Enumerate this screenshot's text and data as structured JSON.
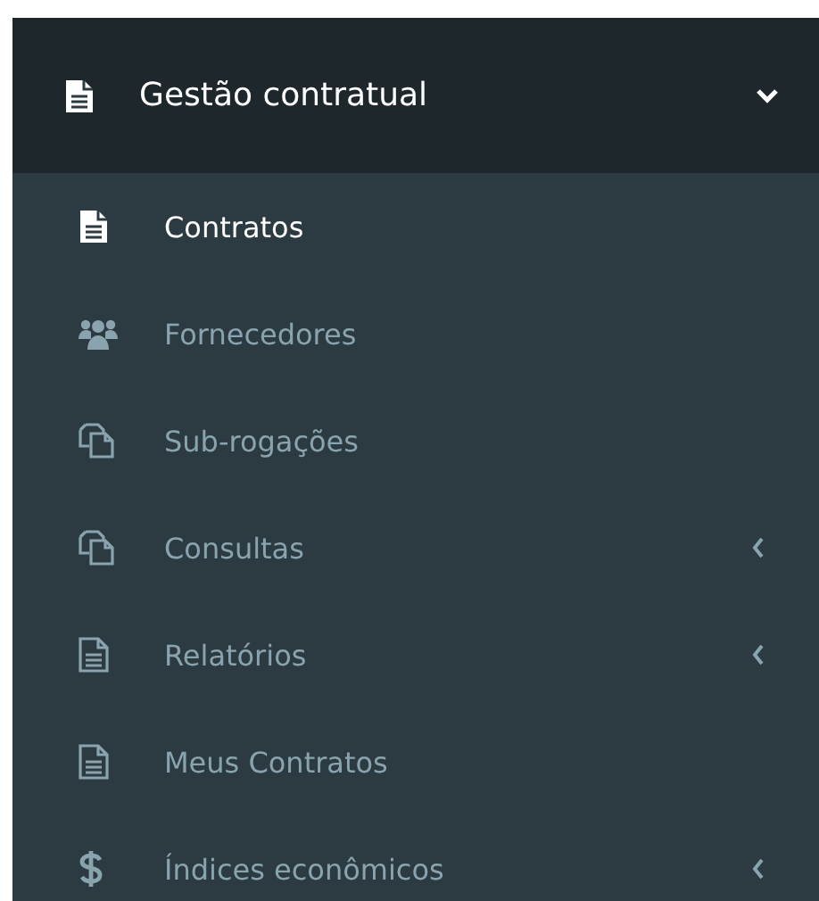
{
  "menu": {
    "title": "Gestão contratual",
    "kind": "doc-filled",
    "expanded": true,
    "items": [
      {
        "label": "Contratos",
        "kind": "doc-filled",
        "selected": true,
        "has_submenu": false
      },
      {
        "label": "Fornecedores",
        "kind": "users",
        "selected": false,
        "has_submenu": false
      },
      {
        "label": "Sub-rogações",
        "kind": "copy",
        "selected": false,
        "has_submenu": false
      },
      {
        "label": "Consultas",
        "kind": "copy",
        "selected": false,
        "has_submenu": true
      },
      {
        "label": "Relatórios",
        "kind": "doc-outline",
        "selected": false,
        "has_submenu": true
      },
      {
        "label": "Meus Contratos",
        "kind": "doc-outline",
        "selected": false,
        "has_submenu": false
      },
      {
        "label": "Índices econômicos",
        "kind": "dollar",
        "selected": false,
        "has_submenu": true
      }
    ]
  }
}
